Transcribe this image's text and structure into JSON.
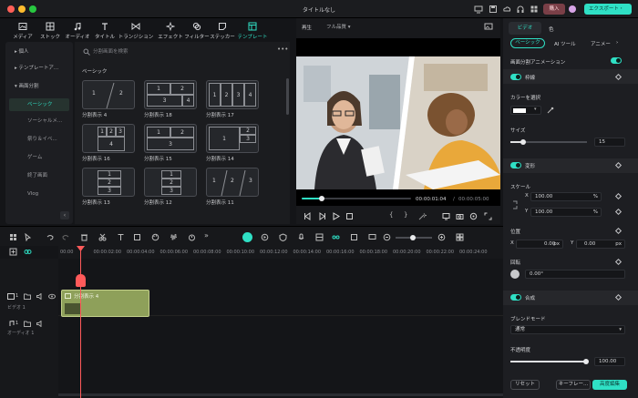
{
  "window": {
    "title": "タイトルなし",
    "buy_label": "購入",
    "export_label": "エクスポート・"
  },
  "toolbar": [
    {
      "label": "メディア",
      "icon": "media-icon"
    },
    {
      "label": "ストック",
      "icon": "stock-icon"
    },
    {
      "label": "オーディオ",
      "icon": "audio-icon"
    },
    {
      "label": "タイトル",
      "icon": "title-icon"
    },
    {
      "label": "トランジション",
      "icon": "transition-icon"
    },
    {
      "label": "エフェクト",
      "icon": "effect-icon"
    },
    {
      "label": "フィルター",
      "icon": "filter-icon"
    },
    {
      "label": "ステッカー",
      "icon": "sticker-icon"
    },
    {
      "label": "テンプレート",
      "icon": "template-icon",
      "active": true
    }
  ],
  "leftnav": [
    {
      "label": "個人",
      "type": "group"
    },
    {
      "label": "テンプレートア...",
      "type": "group"
    },
    {
      "label": "画面分割",
      "type": "group-open"
    },
    {
      "label": "ベーシック",
      "type": "sub",
      "active": true
    },
    {
      "label": "ソーシャルメ...",
      "type": "sub"
    },
    {
      "label": "祭り＆イベ...",
      "type": "sub"
    },
    {
      "label": "ゲーム",
      "type": "sub"
    },
    {
      "label": "終了画面",
      "type": "sub"
    },
    {
      "label": "Vlog",
      "type": "sub"
    }
  ],
  "grid": {
    "search_placeholder": "分割画面を検索",
    "section": "ベーシック",
    "items": [
      {
        "label": "分割表示 4",
        "cells": [
          "1",
          "2"
        ]
      },
      {
        "label": "分割表示 18",
        "cells": [
          "1",
          "2",
          "3",
          "4"
        ]
      },
      {
        "label": "分割表示 17",
        "cells": [
          "1",
          "2",
          "3",
          "4"
        ]
      },
      {
        "label": "分割表示 16",
        "cells": [
          "1",
          "2",
          "3",
          "4"
        ]
      },
      {
        "label": "分割表示 15",
        "cells": [
          "1",
          "2",
          "3"
        ]
      },
      {
        "label": "分割表示 14",
        "cells": [
          "1",
          "2",
          "3"
        ]
      },
      {
        "label": "分割表示 13",
        "cells": [
          "1",
          "2",
          "3"
        ]
      },
      {
        "label": "分割表示 12",
        "cells": [
          "1",
          "2",
          "3"
        ]
      },
      {
        "label": "分割表示 11",
        "cells": [
          "1",
          "2",
          "3"
        ]
      }
    ]
  },
  "preview": {
    "tab": "再生",
    "quality": "フル品質",
    "current_time": "00:00:01:04",
    "total_time": "00:00:05:00",
    "progress": 0.18
  },
  "inspector": {
    "tabs": [
      "ビデオ",
      "色"
    ],
    "subtabs": [
      "ベーシック",
      "AI ツール",
      "アニメー"
    ],
    "split_anim_label": "画面分割アニメーション",
    "border_label": "枠線",
    "color_label": "カラーを選択",
    "size_label": "サイズ",
    "size_value": "15",
    "transform_label": "変形",
    "scale_label": "スケール",
    "scale_x_axis": "X",
    "scale_x": "100.00",
    "scale_y_axis": "Y",
    "scale_y": "100.00",
    "percent": "%",
    "position_label": "位置",
    "pos_x_axis": "X",
    "pos_x": "0.00",
    "pos_y_axis": "Y",
    "pos_y": "0.00",
    "px": "px",
    "rotation_label": "回転",
    "rotation_value": "0.00°",
    "composite_label": "合成",
    "blend_label": "ブレンドモード",
    "blend_value": "通常",
    "opacity_label": "不透明度",
    "opacity_value": "100.00",
    "reset_label": "リセット",
    "keyframe_label": "キーフレー...",
    "advanced_label": "高度編集"
  },
  "timeline": {
    "ruler": [
      "00:00",
      "00:00:02:00",
      "00:00:04:00",
      "00:00:06:00",
      "00:00:08:00",
      "00:00:10:00",
      "00:00:12:00",
      "00:00:14:00",
      "00:00:16:00",
      "00:00:18:00",
      "00:00:20:00",
      "00:00:22:00",
      "00:00:24:00"
    ],
    "video_track": "ビデオ 1",
    "video_track_num": "1",
    "audio_track": "オーディオ 1",
    "audio_track_num": "1",
    "clip_label": "分割表示 4"
  },
  "colors": {
    "accent": "#2fe0c5",
    "clip": "#8ea05a",
    "playhead": "#ff5a5a"
  }
}
